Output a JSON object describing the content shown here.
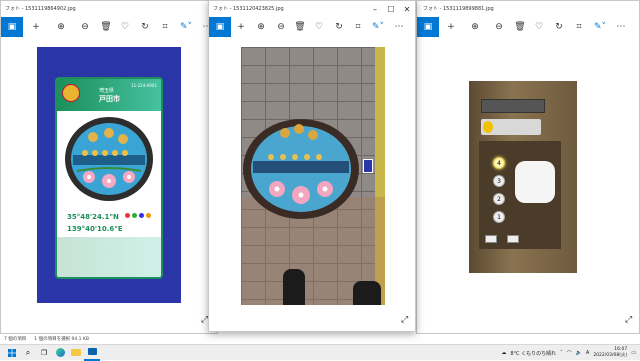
{
  "windows": {
    "left": {
      "title": "フォト - 1531119864902.jpg"
    },
    "center": {
      "title": "フォト - 1531120423825.jpg"
    },
    "right": {
      "title": "フォト - 1531119899881.jpg"
    }
  },
  "card": {
    "prefecture": "埼玉県",
    "city": "戸田市",
    "code": "11-224-A001",
    "lat": "35°48'24.1\"N",
    "lon": "139°40'10.6\"E"
  },
  "elevator": {
    "floors": [
      "4",
      "3",
      "2",
      "1"
    ]
  },
  "statusbar": {
    "items": "7 個の項目",
    "selected": "1 個の項目を選択 94.1 KB"
  },
  "tray": {
    "weather": "8°C くもりのち晴れ",
    "ime": "A",
    "time": "16:07",
    "date": "2022/03/08(火)"
  },
  "colors": {
    "accent": "#0078d4",
    "card_bg": "#2a35a8",
    "taskbar": "#eeeeee"
  }
}
